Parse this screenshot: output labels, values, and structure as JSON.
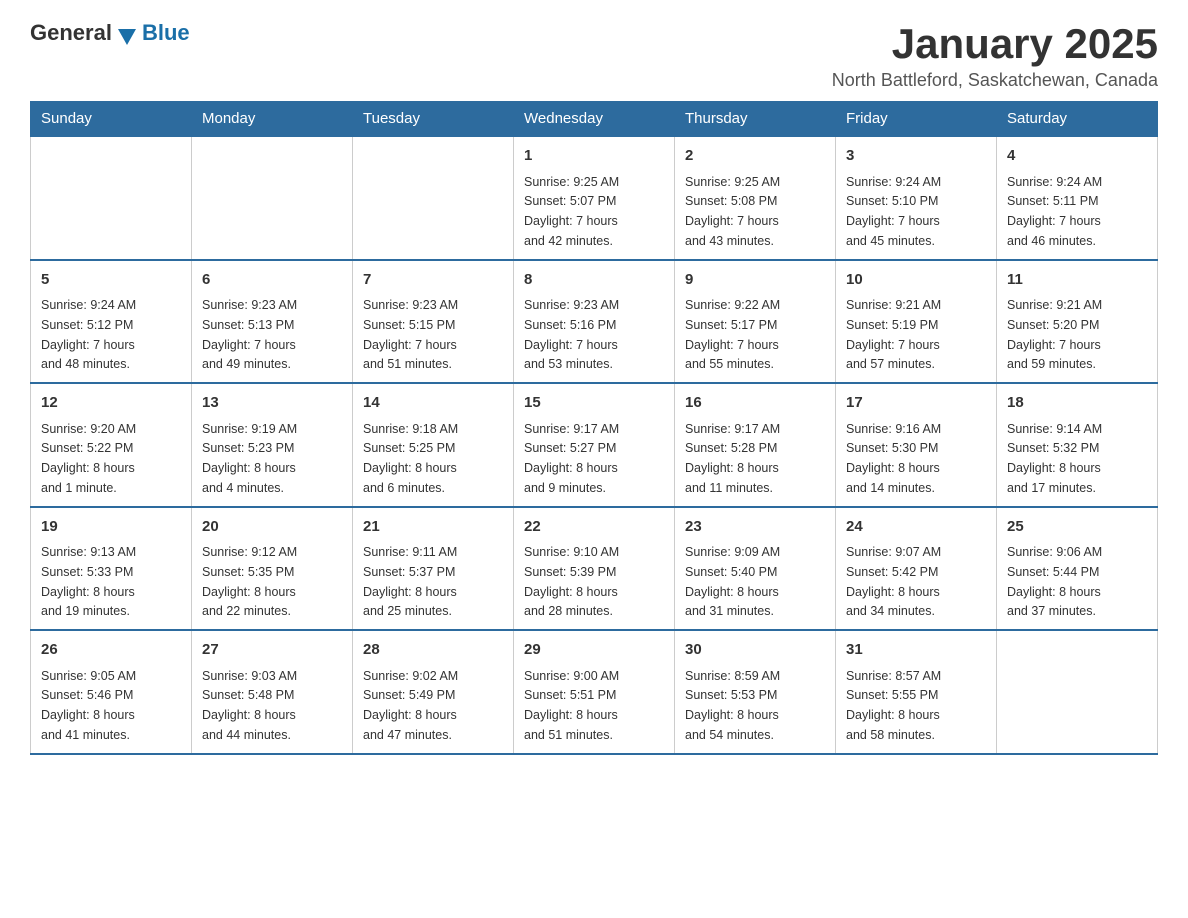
{
  "header": {
    "logo_general": "General",
    "logo_blue": "Blue",
    "month_year": "January 2025",
    "location": "North Battleford, Saskatchewan, Canada"
  },
  "weekdays": [
    "Sunday",
    "Monday",
    "Tuesday",
    "Wednesday",
    "Thursday",
    "Friday",
    "Saturday"
  ],
  "weeks": [
    [
      {
        "day": "",
        "info": ""
      },
      {
        "day": "",
        "info": ""
      },
      {
        "day": "",
        "info": ""
      },
      {
        "day": "1",
        "info": "Sunrise: 9:25 AM\nSunset: 5:07 PM\nDaylight: 7 hours\nand 42 minutes."
      },
      {
        "day": "2",
        "info": "Sunrise: 9:25 AM\nSunset: 5:08 PM\nDaylight: 7 hours\nand 43 minutes."
      },
      {
        "day": "3",
        "info": "Sunrise: 9:24 AM\nSunset: 5:10 PM\nDaylight: 7 hours\nand 45 minutes."
      },
      {
        "day": "4",
        "info": "Sunrise: 9:24 AM\nSunset: 5:11 PM\nDaylight: 7 hours\nand 46 minutes."
      }
    ],
    [
      {
        "day": "5",
        "info": "Sunrise: 9:24 AM\nSunset: 5:12 PM\nDaylight: 7 hours\nand 48 minutes."
      },
      {
        "day": "6",
        "info": "Sunrise: 9:23 AM\nSunset: 5:13 PM\nDaylight: 7 hours\nand 49 minutes."
      },
      {
        "day": "7",
        "info": "Sunrise: 9:23 AM\nSunset: 5:15 PM\nDaylight: 7 hours\nand 51 minutes."
      },
      {
        "day": "8",
        "info": "Sunrise: 9:23 AM\nSunset: 5:16 PM\nDaylight: 7 hours\nand 53 minutes."
      },
      {
        "day": "9",
        "info": "Sunrise: 9:22 AM\nSunset: 5:17 PM\nDaylight: 7 hours\nand 55 minutes."
      },
      {
        "day": "10",
        "info": "Sunrise: 9:21 AM\nSunset: 5:19 PM\nDaylight: 7 hours\nand 57 minutes."
      },
      {
        "day": "11",
        "info": "Sunrise: 9:21 AM\nSunset: 5:20 PM\nDaylight: 7 hours\nand 59 minutes."
      }
    ],
    [
      {
        "day": "12",
        "info": "Sunrise: 9:20 AM\nSunset: 5:22 PM\nDaylight: 8 hours\nand 1 minute."
      },
      {
        "day": "13",
        "info": "Sunrise: 9:19 AM\nSunset: 5:23 PM\nDaylight: 8 hours\nand 4 minutes."
      },
      {
        "day": "14",
        "info": "Sunrise: 9:18 AM\nSunset: 5:25 PM\nDaylight: 8 hours\nand 6 minutes."
      },
      {
        "day": "15",
        "info": "Sunrise: 9:17 AM\nSunset: 5:27 PM\nDaylight: 8 hours\nand 9 minutes."
      },
      {
        "day": "16",
        "info": "Sunrise: 9:17 AM\nSunset: 5:28 PM\nDaylight: 8 hours\nand 11 minutes."
      },
      {
        "day": "17",
        "info": "Sunrise: 9:16 AM\nSunset: 5:30 PM\nDaylight: 8 hours\nand 14 minutes."
      },
      {
        "day": "18",
        "info": "Sunrise: 9:14 AM\nSunset: 5:32 PM\nDaylight: 8 hours\nand 17 minutes."
      }
    ],
    [
      {
        "day": "19",
        "info": "Sunrise: 9:13 AM\nSunset: 5:33 PM\nDaylight: 8 hours\nand 19 minutes."
      },
      {
        "day": "20",
        "info": "Sunrise: 9:12 AM\nSunset: 5:35 PM\nDaylight: 8 hours\nand 22 minutes."
      },
      {
        "day": "21",
        "info": "Sunrise: 9:11 AM\nSunset: 5:37 PM\nDaylight: 8 hours\nand 25 minutes."
      },
      {
        "day": "22",
        "info": "Sunrise: 9:10 AM\nSunset: 5:39 PM\nDaylight: 8 hours\nand 28 minutes."
      },
      {
        "day": "23",
        "info": "Sunrise: 9:09 AM\nSunset: 5:40 PM\nDaylight: 8 hours\nand 31 minutes."
      },
      {
        "day": "24",
        "info": "Sunrise: 9:07 AM\nSunset: 5:42 PM\nDaylight: 8 hours\nand 34 minutes."
      },
      {
        "day": "25",
        "info": "Sunrise: 9:06 AM\nSunset: 5:44 PM\nDaylight: 8 hours\nand 37 minutes."
      }
    ],
    [
      {
        "day": "26",
        "info": "Sunrise: 9:05 AM\nSunset: 5:46 PM\nDaylight: 8 hours\nand 41 minutes."
      },
      {
        "day": "27",
        "info": "Sunrise: 9:03 AM\nSunset: 5:48 PM\nDaylight: 8 hours\nand 44 minutes."
      },
      {
        "day": "28",
        "info": "Sunrise: 9:02 AM\nSunset: 5:49 PM\nDaylight: 8 hours\nand 47 minutes."
      },
      {
        "day": "29",
        "info": "Sunrise: 9:00 AM\nSunset: 5:51 PM\nDaylight: 8 hours\nand 51 minutes."
      },
      {
        "day": "30",
        "info": "Sunrise: 8:59 AM\nSunset: 5:53 PM\nDaylight: 8 hours\nand 54 minutes."
      },
      {
        "day": "31",
        "info": "Sunrise: 8:57 AM\nSunset: 5:55 PM\nDaylight: 8 hours\nand 58 minutes."
      },
      {
        "day": "",
        "info": ""
      }
    ]
  ]
}
